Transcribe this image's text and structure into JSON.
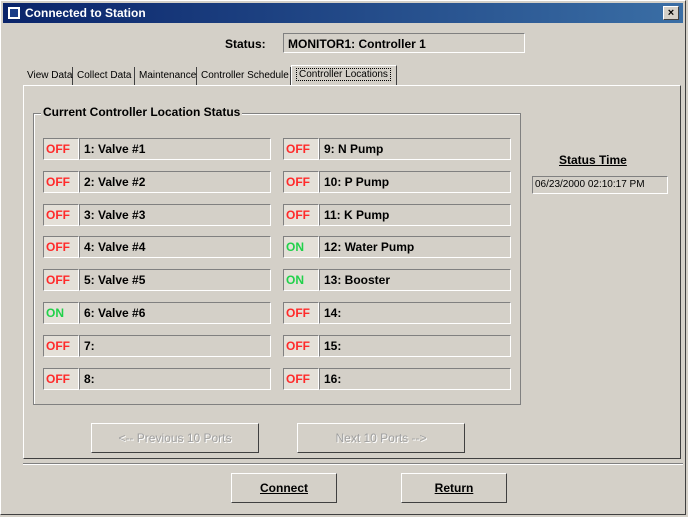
{
  "window": {
    "title": "Connected to Station",
    "close_label": "×"
  },
  "status": {
    "label": "Status:",
    "value": "MONITOR1: Controller 1"
  },
  "tabs": [
    {
      "label": "View Data"
    },
    {
      "label": "Collect Data"
    },
    {
      "label": "Maintenance"
    },
    {
      "label": "Controller Schedule"
    },
    {
      "label": "Controller Locations"
    }
  ],
  "group": {
    "title": "Current Controller Location Status"
  },
  "locations_left": [
    {
      "state": "OFF",
      "name": "1: Valve #1"
    },
    {
      "state": "OFF",
      "name": "2: Valve #2"
    },
    {
      "state": "OFF",
      "name": "3: Valve #3"
    },
    {
      "state": "OFF",
      "name": "4: Valve #4"
    },
    {
      "state": "OFF",
      "name": "5: Valve #5"
    },
    {
      "state": "ON",
      "name": "6: Valve #6"
    },
    {
      "state": "OFF",
      "name": "7:"
    },
    {
      "state": "OFF",
      "name": "8:"
    }
  ],
  "locations_right": [
    {
      "state": "OFF",
      "name": "9: N Pump"
    },
    {
      "state": "OFF",
      "name": "10: P Pump"
    },
    {
      "state": "OFF",
      "name": "11: K Pump"
    },
    {
      "state": "ON",
      "name": "12: Water Pump"
    },
    {
      "state": "ON",
      "name": "13: Booster"
    },
    {
      "state": "OFF",
      "name": "14:"
    },
    {
      "state": "OFF",
      "name": "15:"
    },
    {
      "state": "OFF",
      "name": "16:"
    }
  ],
  "status_time": {
    "label": "Status Time",
    "value": "06/23/2000 02:10:17 PM"
  },
  "buttons": {
    "previous": "<-- Previous 10 Ports",
    "next": "Next 10 Ports -->",
    "connect": "Connect",
    "return": "Return"
  },
  "colors": {
    "off": "#ff2a2a",
    "on": "#21d14a",
    "title_bar": "#0a246a"
  }
}
